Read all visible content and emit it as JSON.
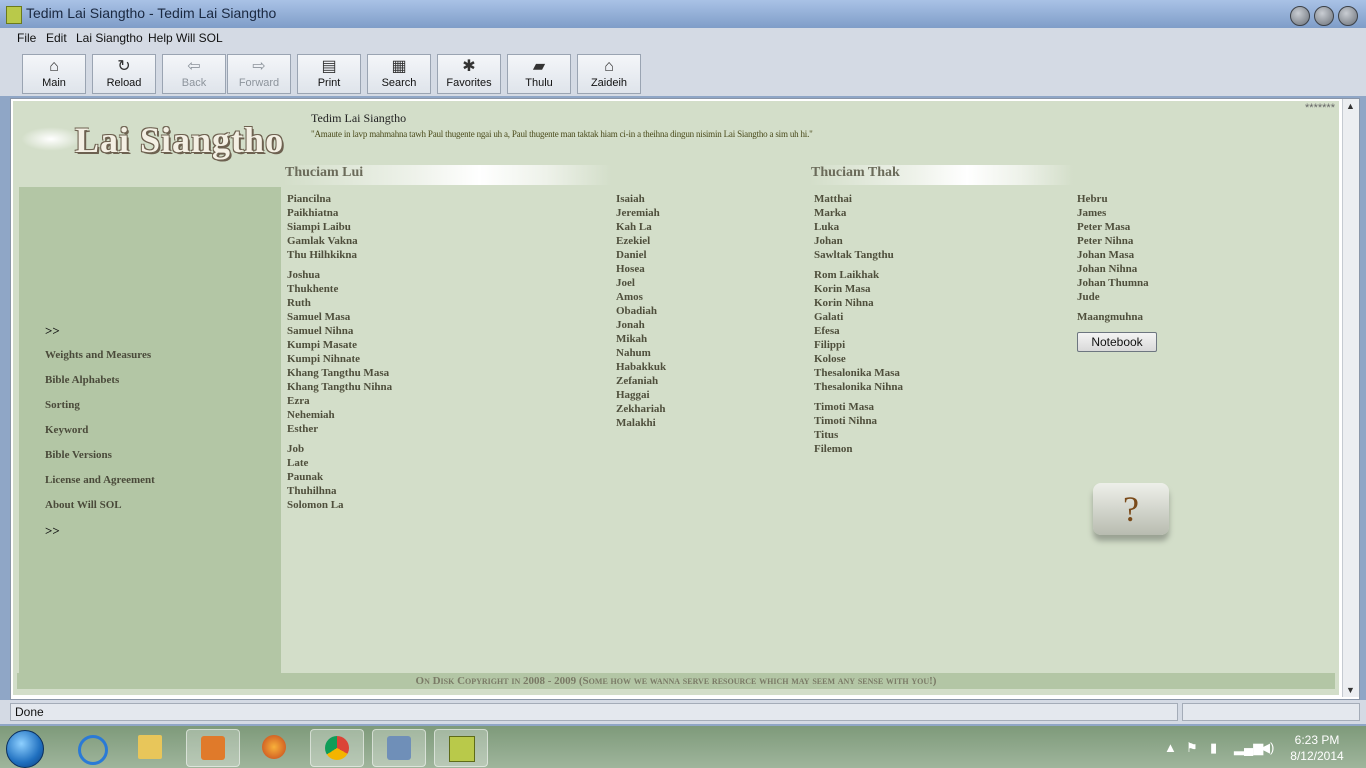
{
  "window": {
    "title": "Tedim Lai Siangtho - Tedim Lai Siangtho"
  },
  "menu": [
    "File",
    "Edit",
    "Lai Siangtho",
    "Help Will SOL"
  ],
  "toolbar": [
    {
      "label": "Main",
      "icon": "home-icon",
      "enabled": true
    },
    {
      "label": "Reload",
      "icon": "reload-icon",
      "enabled": true
    },
    {
      "label": "Back",
      "icon": "back-arrow-icon",
      "enabled": false
    },
    {
      "label": "Forward",
      "icon": "forward-arrow-icon",
      "enabled": false
    },
    {
      "label": "Print",
      "icon": "printer-icon",
      "enabled": true
    },
    {
      "label": "Search",
      "icon": "search-icon",
      "enabled": true
    },
    {
      "label": "Favorites",
      "icon": "favorites-icon",
      "enabled": true
    },
    {
      "label": "Thulu",
      "icon": "book-icon",
      "enabled": true
    },
    {
      "label": "Zaideih",
      "icon": "house-icon",
      "enabled": true
    }
  ],
  "page": {
    "logo_text": "Lai Siangtho",
    "site_title": "Tedim Lai Siangtho",
    "tagline": "\"Amaute in lavp mahmahna tawh Paul thugente ngai uh a, Paul thugente man taktak hiam ci-in a theihna dingun nisimin Lai Siangtho a sim uh hi.\"",
    "stars": "*******",
    "sidebar": {
      "chevron_top": ">>",
      "links": [
        "Weights and Measures",
        "Bible Alphabets",
        "Sorting",
        "Keyword",
        "Bible Versions",
        "License and Agreement",
        "About Will SOL"
      ],
      "chevron_bottom": ">>"
    },
    "old_testament": {
      "heading": "Thuciam Lui",
      "col1": [
        [
          "Piancilna",
          "Paikhiatna",
          "Siampi Laibu",
          "Gamlak Vakna",
          "Thu Hilhkikna"
        ],
        [
          "Joshua",
          "Thukhente",
          "Ruth",
          "Samuel Masa",
          "Samuel Nihna",
          "Kumpi Masate",
          "Kumpi Nihnate",
          "Khang Tangthu Masa",
          "Khang Tangthu Nihna",
          "Ezra",
          "Nehemiah",
          "Esther"
        ],
        [
          "Job",
          "Late",
          "Paunak",
          "Thuhilhna",
          "Solomon La"
        ]
      ],
      "col2": [
        [
          "Isaiah",
          "Jeremiah",
          "Kah La",
          "Ezekiel",
          "Daniel",
          "Hosea",
          "Joel",
          "Amos",
          "Obadiah",
          "Jonah",
          "Mikah",
          "Nahum",
          "Habakkuk",
          "Zefaniah",
          "Haggai",
          "Zekhariah",
          "Malakhi"
        ]
      ]
    },
    "new_testament": {
      "heading": "Thuciam Thak",
      "col1": [
        [
          "Matthai",
          "Marka",
          "Luka",
          "Johan",
          "Sawltak Tangthu"
        ],
        [
          "Rom Laikhak",
          "Korin Masa",
          "Korin Nihna",
          "Galati",
          "Efesa",
          "Filippi",
          "Kolose",
          "Thesalonika Masa",
          "Thesalonika Nihna"
        ],
        [
          "Timoti Masa",
          "Timoti Nihna",
          "Titus",
          "Filemon"
        ]
      ],
      "col2": [
        [
          "Hebru",
          "James",
          "Peter Masa",
          "Peter Nihna",
          "Johan Masa",
          "Johan Nihna",
          "Johan Thumna",
          "Jude"
        ],
        [
          "Maangmuhna"
        ]
      ]
    },
    "notebook_label": "Notebook",
    "help_glyph": "?",
    "footer": "On Disk Copyright in 2008 - 2009 (Some how we wanna serve resource which may seem any sense with you!)"
  },
  "status": {
    "text": "Done"
  },
  "taskbar": {
    "time": "6:23 PM",
    "date": "8/12/2014"
  },
  "colors": {
    "page_bg": "#d3dec9",
    "sidebar_bg": "#b3c6a5",
    "link_text": "#4f4f3c"
  }
}
